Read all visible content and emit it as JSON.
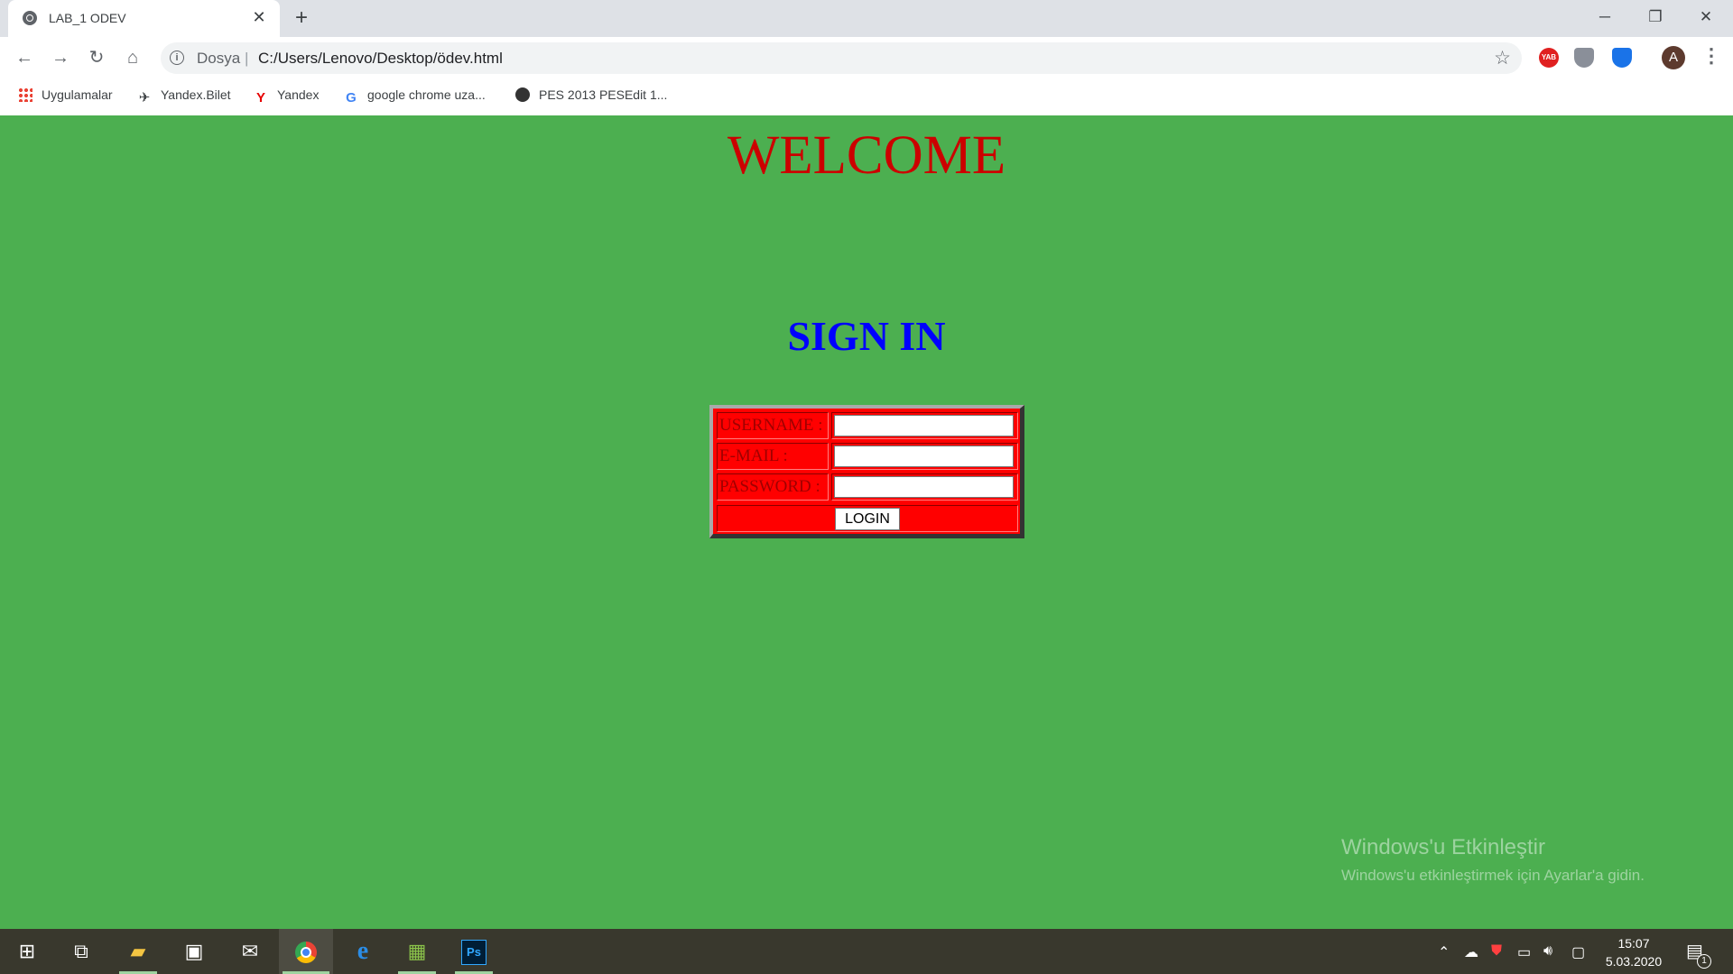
{
  "browser": {
    "tab": {
      "title": "LAB_1 ODEV",
      "close": "✕"
    },
    "new_tab": "+",
    "window_controls": {
      "minimize": "─",
      "maximize": "❐",
      "close": "✕"
    },
    "toolbar": {
      "back": "←",
      "forward": "→",
      "reload": "↻",
      "home": "⌂",
      "address_scheme": "Dosya",
      "address_url": "C:/Users/Lenovo/Desktop/ödev.html",
      "avatar_letter": "A"
    },
    "extensions": [
      {
        "name": "yab-extension-icon",
        "label": "YAB",
        "color": "#e02020"
      },
      {
        "name": "shield-extension-icon",
        "label": "",
        "color": "#8a8f99"
      },
      {
        "name": "blue-shield-extension-icon",
        "label": "",
        "color": "#1a73e8"
      }
    ],
    "bookmarks": [
      {
        "label": "Uygulamalar",
        "icon": "apps-grid-icon"
      },
      {
        "label": "Yandex.Bilet",
        "icon": "plane-icon"
      },
      {
        "label": "Yandex",
        "icon": "yandex-icon"
      },
      {
        "label": "google chrome uza...",
        "icon": "google-icon"
      },
      {
        "label": "PES 2013 PESEdit 1...",
        "icon": "pes-icon"
      }
    ]
  },
  "page": {
    "heading": "WELCOME",
    "subheading": "SIGN IN",
    "form": {
      "username_label": "USERNAME :",
      "email_label": "E-MAIL :",
      "password_label": "PASSWORD :",
      "username_value": "",
      "email_value": "",
      "password_value": "",
      "login_button": "LOGIN"
    },
    "colors": {
      "background": "#4caf50",
      "heading": "#cc0000",
      "subheading": "#0000ff",
      "form_bg": "#ff0000"
    },
    "watermark": {
      "title": "Windows'u Etkinleştir",
      "subtitle": "Windows'u etkinleştirmek için Ayarlar'a gidin."
    }
  },
  "taskbar": {
    "apps": [
      "start-icon",
      "task-view-icon",
      "file-explorer-icon",
      "store-icon",
      "mail-icon",
      "chrome-icon",
      "edge-icon",
      "image-viewer-icon",
      "photoshop-icon"
    ],
    "clock_time": "15:07",
    "clock_date": "5.03.2020",
    "notification_count": "1"
  }
}
